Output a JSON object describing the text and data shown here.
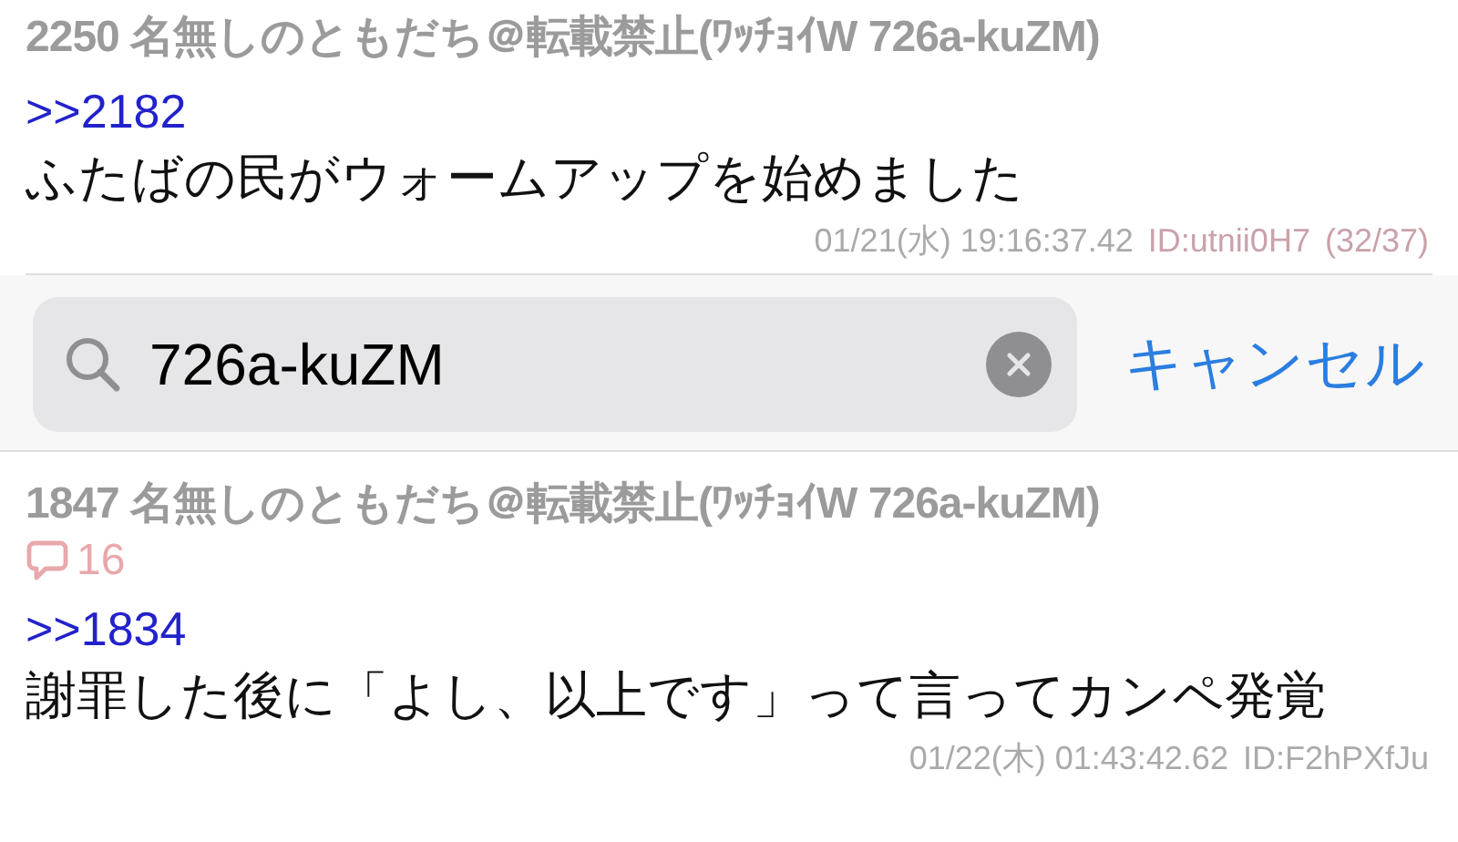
{
  "posts_above": [
    {
      "number": "2250",
      "name": "名無しのともだち＠転載禁止(ﾜｯﾁｮｲW 726a-kuZM)",
      "anchor": ">>2182",
      "body": "ふたばの民がウォームアップを始めました",
      "date": "01/21(水) 19:16:37.42",
      "id": "ID:utnii0H7",
      "id_highlighted": true,
      "count": "(32/37)"
    }
  ],
  "search": {
    "value": "726a-kuZM",
    "cancel": "キャンセル"
  },
  "posts_below": [
    {
      "number": "1847",
      "name": "名無しのともだち＠転載禁止(ﾜｯﾁｮｲW 726a-kuZM)",
      "replies": "16",
      "anchor": ">>1834",
      "body": "謝罪した後に「よし、以上です」って言ってカンペ発覚",
      "date": "01/22(木) 01:43:42.62",
      "id": "ID:F2hPXfJu",
      "id_highlighted": false
    }
  ]
}
